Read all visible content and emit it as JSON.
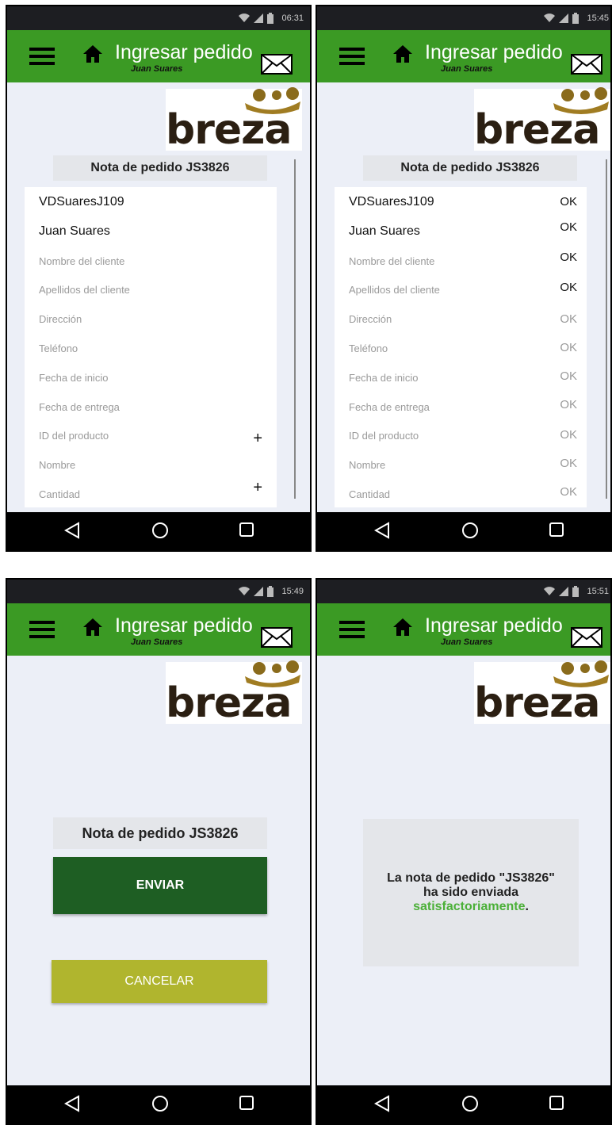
{
  "app": {
    "title": "Ingresar pedido",
    "user": "Juan Suares",
    "brand": "breza",
    "colors": {
      "appbar": "#3b9a24",
      "send_button": "#1e5e23",
      "cancel_button": "#b0b52e",
      "success": "#4bb038"
    }
  },
  "screens": [
    {
      "time": "06:31"
    },
    {
      "time": "15:45"
    },
    {
      "time": "15:49"
    },
    {
      "time": "15:51"
    }
  ],
  "order": {
    "note_label": "Nota de pedido JS3826",
    "fields": [
      {
        "label": "VDSuaresJ109",
        "filled": true
      },
      {
        "label": "Juan Suares",
        "filled": true
      },
      {
        "label": "Nombre del cliente",
        "filled": false
      },
      {
        "label": "Apellidos del cliente",
        "filled": false
      },
      {
        "label": "Dirección",
        "filled": false
      },
      {
        "label": "Teléfono",
        "filled": false
      },
      {
        "label": "Fecha de inicio",
        "filled": false
      },
      {
        "label": "Fecha de entrega",
        "filled": false
      },
      {
        "label": "ID del producto",
        "filled": false
      },
      {
        "label": "Nombre",
        "filled": false
      },
      {
        "label": "Cantidad",
        "filled": false
      }
    ],
    "plus_symbol": "+",
    "ok_label": "OK"
  },
  "actions": {
    "send_label": "ENVIAR",
    "cancel_label": "CANCELAR"
  },
  "confirmation": {
    "line1": "La nota de pedido \"JS3826\"",
    "line2": "ha sido enviada",
    "success_word": "satisfactoriamente",
    "period": "."
  },
  "icons": [
    "menu-icon",
    "home-icon",
    "mail-icon",
    "wifi-icon",
    "signal-icon",
    "battery-icon",
    "back-icon",
    "home-circle-icon",
    "recents-icon"
  ]
}
